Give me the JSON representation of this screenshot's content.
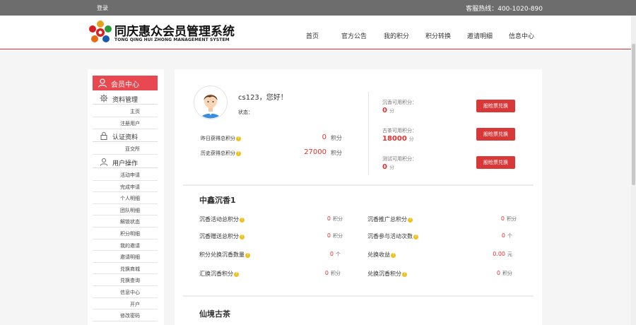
{
  "topbar": {
    "login": "登录",
    "hotline": "客服热线：400-1020-890"
  },
  "brand": {
    "name_cn": "同庆惠众会员管理系统",
    "name_en": "TONG QING HUI ZHONG MANAGEMENT SYSTEM"
  },
  "nav": [
    "首页",
    "官方公告",
    "我的积分",
    "积分转换",
    "邀请明细",
    "信息中心"
  ],
  "sidebar": {
    "active": "会员中心",
    "groups": [
      {
        "label": "资料管理",
        "icon": "gear-icon",
        "items": [
          "主页",
          "注册用户"
        ]
      },
      {
        "label": "认证资料",
        "icon": "lock-icon",
        "items": [
          "亚交所"
        ]
      },
      {
        "label": "用户操作",
        "icon": "user-icon",
        "items": [
          "活动申请",
          "完成申请",
          "个人明细",
          "团队明细",
          "解锁状态",
          "积分明细",
          "我的邀请",
          "邀请明细",
          "兑换商城",
          "兑换查询",
          "信息中心",
          "开户",
          "修改密码"
        ]
      }
    ]
  },
  "profile": {
    "greeting": "cs123，您好！",
    "status_label": "状态：",
    "yesterday_label": "昨日获得总积分",
    "yesterday_value": "0",
    "history_label": "历史获得总积分",
    "history_value": "27000",
    "unit": "积分"
  },
  "balances": [
    {
      "label": "沉香可用积分：",
      "value": "0",
      "unit": "分",
      "button": "股睑票兑换"
    },
    {
      "label": "古茶可用积分：",
      "value": "18000",
      "unit": "分",
      "button": "股睑票兑换"
    },
    {
      "label": "测试可用积分：",
      "value": "0",
      "unit": "分",
      "button": "股睑票兑换"
    }
  ],
  "section1": {
    "title": "中鑫沉香1",
    "rows": [
      [
        {
          "label": "沉香活动总积分",
          "value": "0",
          "unit": "积分"
        },
        {
          "label": "沉香推广总积分",
          "value": "0",
          "unit": "积分"
        }
      ],
      [
        {
          "label": "沉香赠送总积分",
          "value": "0",
          "unit": "积分"
        },
        {
          "label": "沉香参与活动次数",
          "value": "0",
          "unit": "个"
        }
      ],
      [
        {
          "label": "积分兑换沉香数量",
          "value": "0",
          "unit": "个"
        },
        {
          "label": "兑换收益",
          "value": "0.00",
          "unit": "元"
        }
      ],
      [
        {
          "label": "汇换沉香积分",
          "value": "0",
          "unit": "积分"
        },
        {
          "label": "兑换沉香积分",
          "value": "0",
          "unit": "积分"
        }
      ]
    ]
  },
  "section2": {
    "title": "仙境古茶"
  },
  "colors": {
    "accent": "#e84850",
    "topbar": "#6d6d6d",
    "value_red": "#e03030"
  }
}
